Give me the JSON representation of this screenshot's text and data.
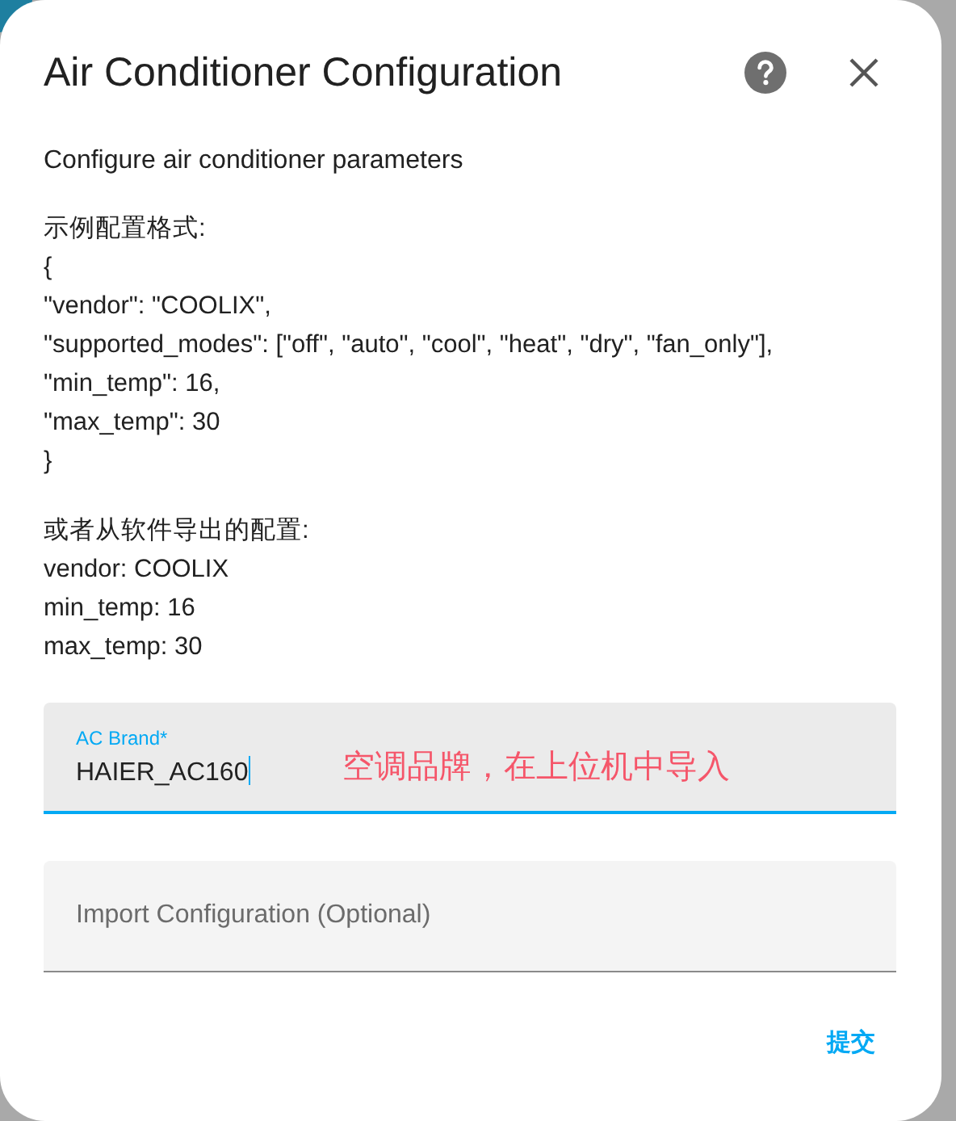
{
  "dialog": {
    "title": "Air Conditioner Configuration",
    "description": "Configure air conditioner parameters",
    "blocks": [
      "示例配置格式:\n{\n\"vendor\": \"COOLIX\",\n\"supported_modes\": [\"off\", \"auto\", \"cool\", \"heat\", \"dry\", \"fan_only\"],\n\"min_temp\": 16,\n\"max_temp\": 30\n}",
      "或者从软件导出的配置:\nvendor: COOLIX\nmin_temp: 16\nmax_temp: 30"
    ],
    "fields": [
      {
        "label": "AC Brand*",
        "value": "HAIER_AC160",
        "focused": true
      },
      {
        "placeholder": "Import Configuration (Optional)",
        "focused": false
      }
    ],
    "annotation": "空调品牌，在上位机中导入",
    "buttons": [
      "提交"
    ]
  }
}
